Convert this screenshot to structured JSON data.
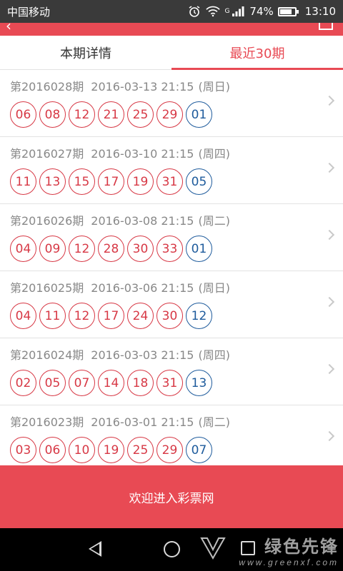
{
  "status_bar": {
    "carrier": "中国移动",
    "battery_percent": "74%",
    "battery_level": 0.74,
    "time": "13:10",
    "signal_type": "G",
    "icons": [
      "alarm-icon",
      "wifi-icon",
      "signal-icon",
      "battery-icon"
    ]
  },
  "header": {
    "back_icon": "back-arrow-icon",
    "menu_icon": "share-icon"
  },
  "tabs": [
    {
      "label": "本期详情",
      "active": false
    },
    {
      "label": "最近30期",
      "active": true
    }
  ],
  "draws": [
    {
      "issue": "第2016028期",
      "date": "2016-03-13 21:15",
      "weekday": "(周日)",
      "red": [
        "06",
        "08",
        "12",
        "21",
        "25",
        "29"
      ],
      "blue": "01"
    },
    {
      "issue": "第2016027期",
      "date": "2016-03-10 21:15",
      "weekday": "(周四)",
      "red": [
        "11",
        "13",
        "15",
        "17",
        "19",
        "31"
      ],
      "blue": "05"
    },
    {
      "issue": "第2016026期",
      "date": "2016-03-08 21:15",
      "weekday": "(周二)",
      "red": [
        "04",
        "09",
        "12",
        "28",
        "30",
        "33"
      ],
      "blue": "01"
    },
    {
      "issue": "第2016025期",
      "date": "2016-03-06 21:15",
      "weekday": "(周日)",
      "red": [
        "04",
        "11",
        "12",
        "17",
        "24",
        "30"
      ],
      "blue": "12"
    },
    {
      "issue": "第2016024期",
      "date": "2016-03-03 21:15",
      "weekday": "(周四)",
      "red": [
        "02",
        "05",
        "07",
        "14",
        "18",
        "31"
      ],
      "blue": "13"
    },
    {
      "issue": "第2016023期",
      "date": "2016-03-01 21:15",
      "weekday": "(周二)",
      "red": [
        "03",
        "06",
        "10",
        "19",
        "25",
        "29"
      ],
      "blue": "07"
    }
  ],
  "banner": {
    "text": "欢迎进入彩票网"
  },
  "watermark": {
    "main": "绿色先锋",
    "sub": "www.greenxf.com"
  },
  "colors": {
    "accent": "#e84a54",
    "red_ball": "#d73845",
    "blue_ball": "#1e5b9c"
  }
}
